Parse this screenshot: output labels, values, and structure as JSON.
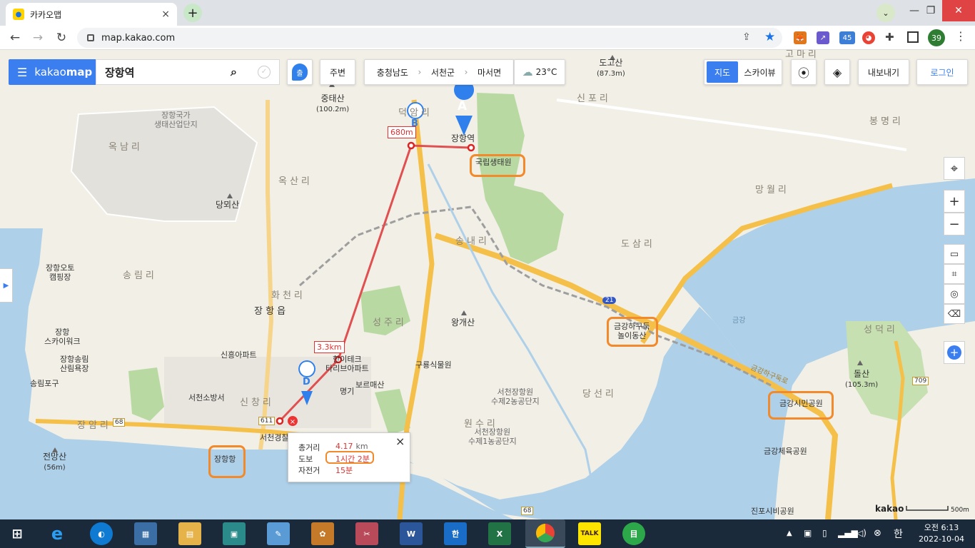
{
  "browser": {
    "tab_title": "카카오맵",
    "tab_close": "×",
    "new_tab": "+",
    "url": "map.kakao.com",
    "profile_badge": "39",
    "ext_badge": "45",
    "window_controls": {
      "minimize": "—",
      "restore": "❐",
      "close": "✕"
    }
  },
  "map_ui": {
    "logo_prefix": "kakao",
    "logo_suffix": "map",
    "search_value": "장항역",
    "marker_button": "출",
    "nearby_button": "주변",
    "breadcrumb": [
      "충청남도",
      "서천군",
      "마서면"
    ],
    "weather": "23°C",
    "map_type_normal": "지도",
    "map_type_sky": "스카이뷰",
    "export_button": "내보내기",
    "login_button": "로그인",
    "scale_label": "500m",
    "watermark": "kakao"
  },
  "route": {
    "total_label": "총거리",
    "total_value": "4.17",
    "total_unit": "km",
    "walk_label": "도보",
    "walk_value": "1시간 2분",
    "bike_label": "자전거",
    "bike_value": "15분",
    "close": "×",
    "segment_1": "680m",
    "segment_2": "3.3km",
    "markers": [
      "A",
      "B",
      "D"
    ]
  },
  "map_labels": {
    "jungtaesan": "중태산",
    "jungtaesan_h": "(100.2m)",
    "dogosan": "도고산",
    "dogosan_h": "(87.3m)",
    "gomari": "고마리",
    "janghang_gukga": "장항국가\n생태산업단지",
    "oknamri": "옥남리",
    "deokamri": "덕암리",
    "janghang_station": "장항역",
    "sinpori": "신포리",
    "bongmyeongri": "봉명리",
    "gungnip": "국립생태원",
    "oksanri": "옥산리",
    "dangoesan": "당뫼산",
    "mangwolri": "망월리",
    "songnaeri": "송내리",
    "dosamri": "도삼리",
    "janghang_auto": "장항오토\n캠핑장",
    "songrimri": "송림리",
    "hwacheonri": "화천리",
    "janghangeup": "장 항 읍",
    "route21": "21",
    "wanggaesan": "왕개산",
    "geumgang_haguduk": "금강하구둑\n놀이동산",
    "geumgang": "금강",
    "seongdeokri": "성덕리",
    "janghang_skywalk": "장항\n스카이워크",
    "songnim_sanrim": "장항송림\n산림욕장",
    "songnim_port": "송림포구",
    "sinheung_apt": "신흥아파트",
    "hanitek": "한이테크\n타리브아파트",
    "sinseongri": "성주리",
    "guryong": "구룡식물원",
    "dolsan": "돌산",
    "dolsan_h": "(105.3m)",
    "seocheon_fire": "서천소방서",
    "sinchangri": "신창리",
    "myeonggi": "명기",
    "boreumaesan": "보르매산",
    "seocheon_2": "서천장항원\n수제2농공단지",
    "dangseonri": "당선리",
    "geumgang_park": "금강시민공원",
    "route709": "709",
    "route611": "611",
    "route68a": "68",
    "route68b": "68",
    "janghangri": "장암리",
    "seocheon_police": "서천경찰",
    "wonsuri": "원수리",
    "seocheon_1": "서천장항원\n수제1농공단지",
    "jeonmangsan": "전망산",
    "jeonmangsan_h": "(56m)",
    "janghang_port": "장항항",
    "geumgang_sports": "금강체육공원",
    "jinpo_park": "진포시비공원",
    "geumgang_bridge": "금강하구둑로"
  },
  "taskbar": {
    "time": "오전 6:13",
    "date": "2022-10-04",
    "ime": "한"
  }
}
